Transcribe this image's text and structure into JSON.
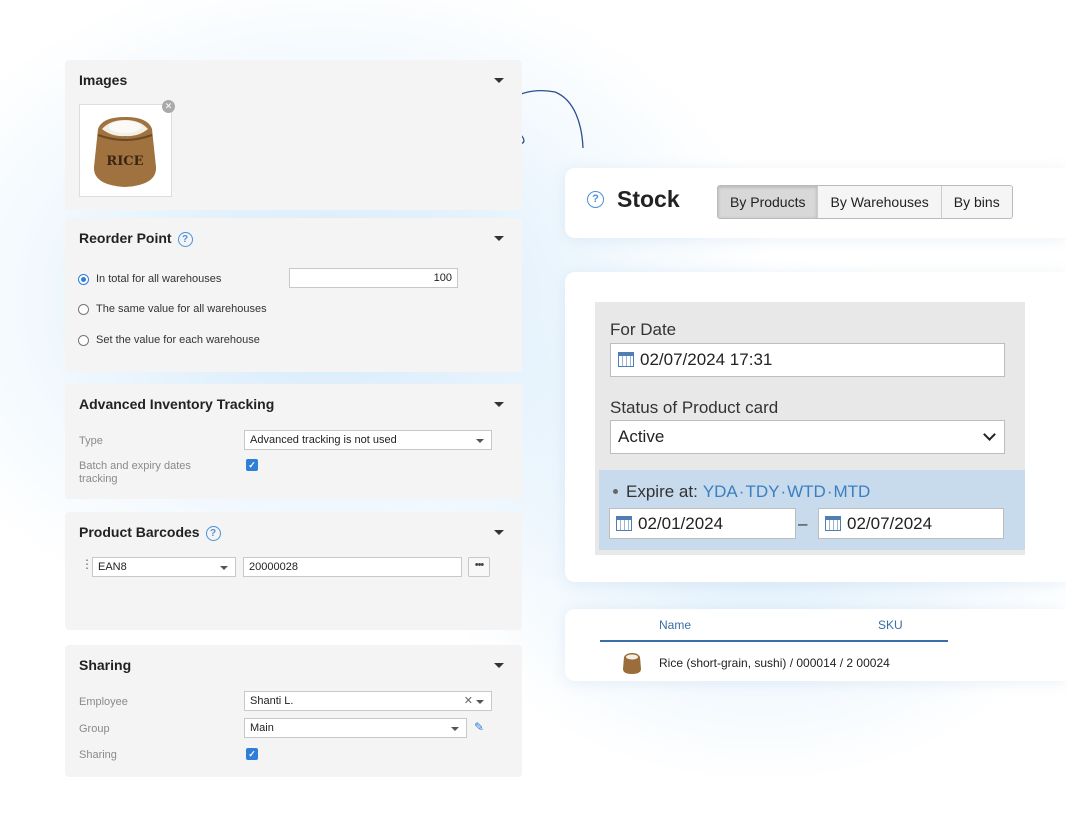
{
  "images": {
    "title": "Images"
  },
  "reorder_point": {
    "title": "Reorder Point",
    "help": "?",
    "options": [
      {
        "label": "In total for all warehouses",
        "selected": true
      },
      {
        "label": "The same value for all warehouses",
        "selected": false
      },
      {
        "label": "Set the value for each warehouse",
        "selected": false
      }
    ],
    "total_value": "100"
  },
  "advanced_tracking": {
    "title": "Advanced Inventory Tracking",
    "type_label": "Type",
    "type_value": "Advanced tracking is not used",
    "batch_label": "Batch and expiry dates tracking",
    "batch_checked": true
  },
  "barcodes": {
    "title": "Product Barcodes",
    "help": "?",
    "type_value": "EAN8",
    "code_value": "20000028",
    "more_label": "•••"
  },
  "sharing": {
    "title": "Sharing",
    "employee_label": "Employee",
    "employee_value": "Shanti L.",
    "group_label": "Group",
    "group_value": "Main",
    "sharing_label": "Sharing",
    "sharing_checked": true
  },
  "stock": {
    "title": "Stock",
    "help": "?",
    "tabs": [
      {
        "label": "By Products",
        "active": true
      },
      {
        "label": "By Warehouses",
        "active": false
      },
      {
        "label": "By bins",
        "active": false
      }
    ]
  },
  "filters": {
    "for_date_label": "For Date",
    "for_date_value": "02/07/2024 17:31",
    "status_label": "Status of Product card",
    "status_value": "Active",
    "expire_label": "Expire at:",
    "quick_ranges": [
      "YDA",
      "TDY",
      "WTD",
      "MTD"
    ],
    "expire_from": "02/01/2024",
    "expire_separator": "–",
    "expire_to": "02/07/2024"
  },
  "table": {
    "columns": [
      "Name",
      "SKU"
    ],
    "rows": [
      {
        "name": "Rice (short-grain, sushi) / 000014 / 2 00024"
      }
    ]
  },
  "colors": {
    "accent": "#2f7ed8",
    "link": "#3b7fc0",
    "panel": "#f4f4f4"
  }
}
